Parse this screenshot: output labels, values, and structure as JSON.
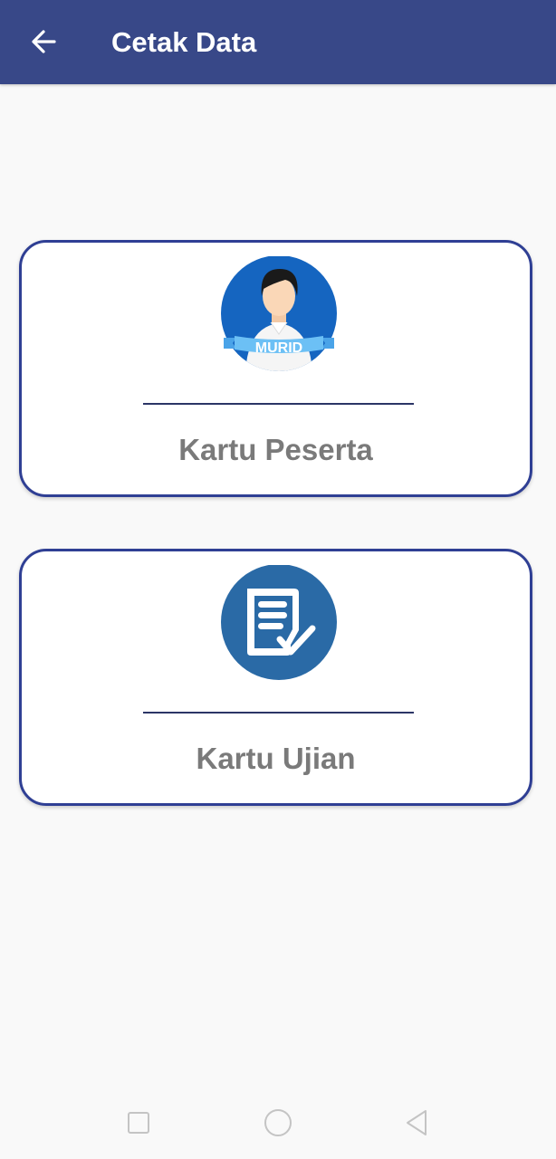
{
  "app_bar": {
    "title": "Cetak Data",
    "back_icon": "arrow-left-icon",
    "background_color": "#384888"
  },
  "cards": [
    {
      "label": "Kartu Peserta",
      "icon": "student-avatar-icon",
      "icon_badge_text": "MURID"
    },
    {
      "label": "Kartu Ujian",
      "icon": "document-check-icon"
    }
  ],
  "nav_bar": {
    "recent_icon": "square-icon",
    "home_icon": "circle-icon",
    "back_icon": "triangle-back-icon"
  }
}
